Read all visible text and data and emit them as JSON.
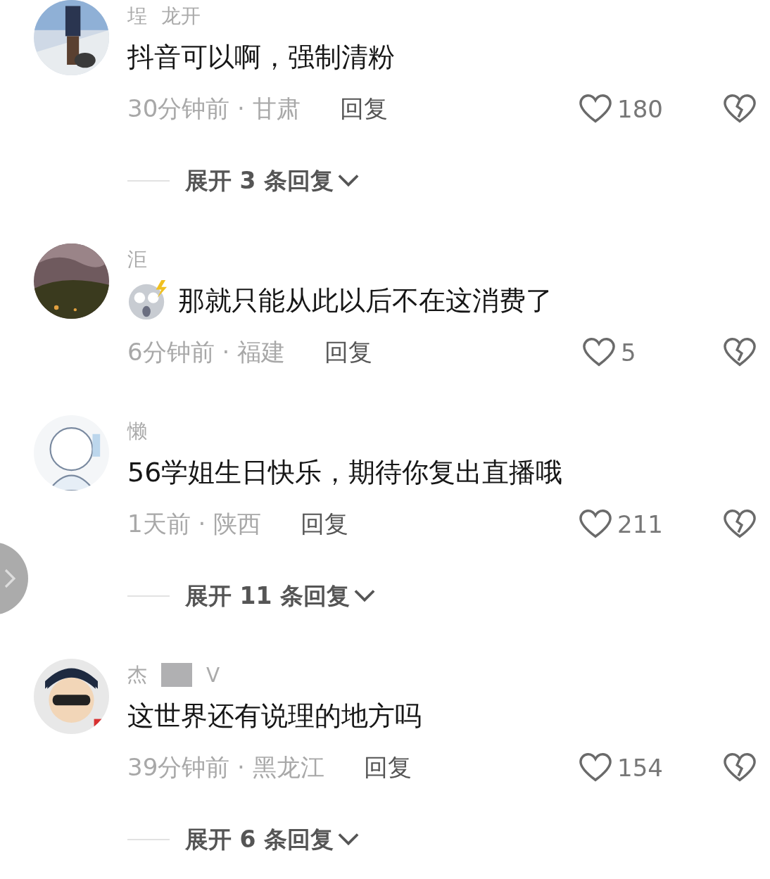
{
  "comments": [
    {
      "name_parts": [
        "埕",
        "龙开"
      ],
      "redacted": false,
      "has_emoji": false,
      "text": "抖音可以啊，强制清粉",
      "meta": "30分钟前 · 甘肃",
      "reply": "回复",
      "likes": "180",
      "expand": "展开 3 条回复"
    },
    {
      "name_parts": [
        "洰"
      ],
      "redacted": false,
      "has_emoji": true,
      "text": "那就只能从此以后不在这消费了",
      "meta": "6分钟前 · 福建",
      "reply": "回复",
      "likes": "5"
    },
    {
      "name_parts": [
        "懒"
      ],
      "redacted": false,
      "has_emoji": false,
      "text": "56学姐生日快乐，期待你复出直播哦",
      "meta": "1天前 · 陕西",
      "reply": "回复",
      "likes": "211",
      "expand": "展开 11 条回复"
    },
    {
      "name_parts": [
        "杰",
        "V"
      ],
      "redacted": true,
      "has_emoji": false,
      "text": "这世界还有说理的地方吗",
      "meta": "39分钟前 · 黑龙江",
      "reply": "回复",
      "likes": "154",
      "expand": "展开 6 条回复"
    }
  ]
}
